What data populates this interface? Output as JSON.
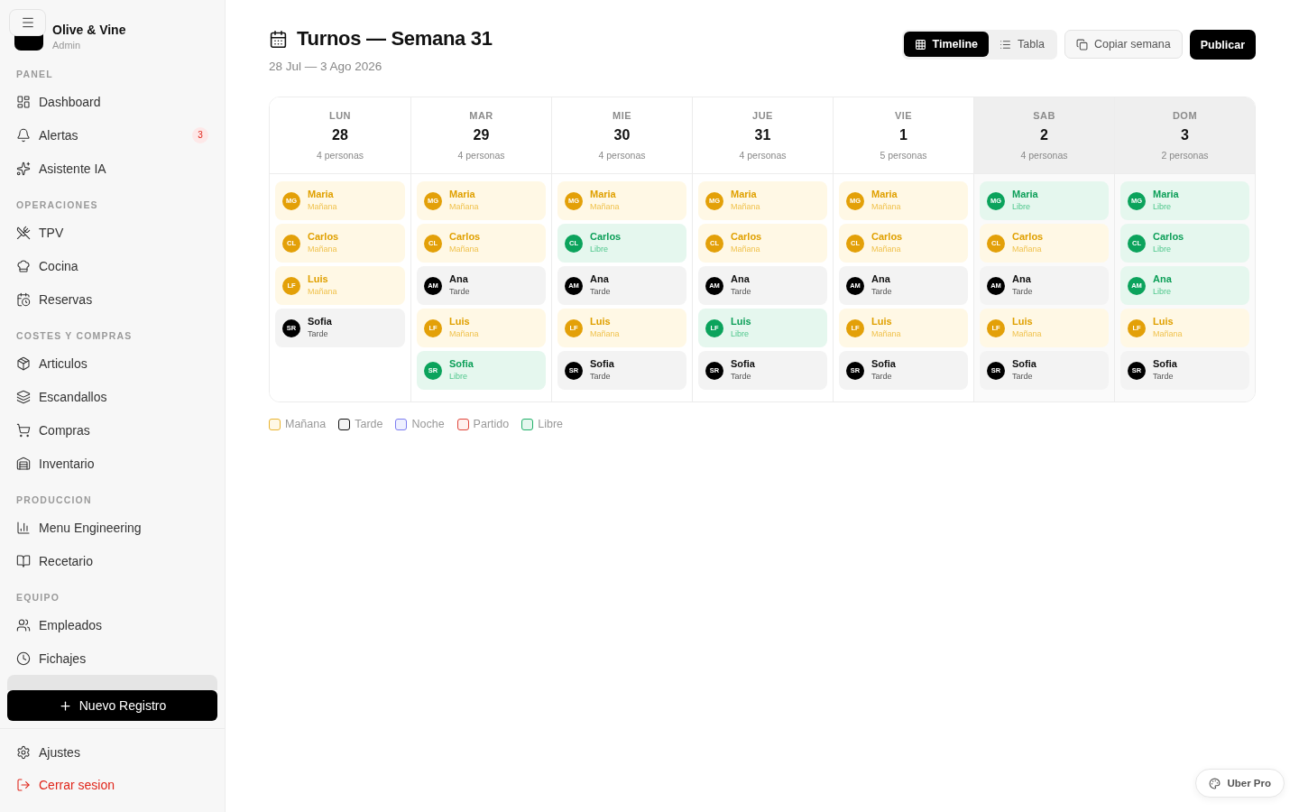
{
  "sidebar": {
    "brand": {
      "name": "Olive & Vine",
      "role": "Admin"
    },
    "sections": [
      {
        "title": "PANEL",
        "items": [
          {
            "label": "Dashboard",
            "selected": false
          },
          {
            "label": "Alertas",
            "badge": "3",
            "selected": false
          },
          {
            "label": "Asistente IA",
            "selected": false
          }
        ]
      },
      {
        "title": "OPERACIONES",
        "items": [
          {
            "label": "TPV",
            "selected": false
          },
          {
            "label": "Cocina",
            "selected": false
          },
          {
            "label": "Reservas",
            "selected": false
          }
        ]
      },
      {
        "title": "COSTES Y COMPRAS",
        "items": [
          {
            "label": "Articulos",
            "selected": false
          },
          {
            "label": "Escandallos",
            "selected": false
          },
          {
            "label": "Compras",
            "selected": false
          },
          {
            "label": "Inventario",
            "selected": false
          }
        ]
      },
      {
        "title": "PRODUCCION",
        "items": [
          {
            "label": "Menu Engineering",
            "selected": false
          },
          {
            "label": "Recetario",
            "selected": false
          }
        ]
      },
      {
        "title": "EQUIPO",
        "items": [
          {
            "label": "Empleados",
            "selected": false
          },
          {
            "label": "Fichajes",
            "selected": false
          },
          {
            "selected": true
          }
        ]
      }
    ],
    "primary_button": "Nuevo Registro",
    "footer": [
      {
        "label": "Ajustes",
        "kind": "normal"
      },
      {
        "label": "Cerrar sesion",
        "kind": "danger"
      }
    ]
  },
  "header": {
    "title": "Turnos — Semana 31",
    "subtitle": "28 Jul — 3 Ago 2026",
    "views": [
      {
        "label": "Timeline",
        "selected": true
      },
      {
        "label": "Tabla",
        "selected": false
      }
    ],
    "copy_button": "Copiar semana",
    "publish_button": "Publicar"
  },
  "days": [
    {
      "dow": "LUN",
      "date": "28",
      "count": "4 personas",
      "weekend": false,
      "shifts": [
        {
          "initials": "MG",
          "name": "Maria",
          "shift": "Mañana",
          "kind": "manana"
        },
        {
          "initials": "CL",
          "name": "Carlos",
          "shift": "Mañana",
          "kind": "manana"
        },
        {
          "initials": "LF",
          "name": "Luis",
          "shift": "Mañana",
          "kind": "manana"
        },
        {
          "initials": "SR",
          "name": "Sofia",
          "shift": "Tarde",
          "kind": "tarde"
        }
      ]
    },
    {
      "dow": "MAR",
      "date": "29",
      "count": "4 personas",
      "weekend": false,
      "shifts": [
        {
          "initials": "MG",
          "name": "Maria",
          "shift": "Mañana",
          "kind": "manana"
        },
        {
          "initials": "CL",
          "name": "Carlos",
          "shift": "Mañana",
          "kind": "manana"
        },
        {
          "initials": "AM",
          "name": "Ana",
          "shift": "Tarde",
          "kind": "tarde"
        },
        {
          "initials": "LF",
          "name": "Luis",
          "shift": "Mañana",
          "kind": "manana"
        },
        {
          "initials": "SR",
          "name": "Sofia",
          "shift": "Libre",
          "kind": "libre"
        }
      ]
    },
    {
      "dow": "MIE",
      "date": "30",
      "count": "4 personas",
      "weekend": false,
      "shifts": [
        {
          "initials": "MG",
          "name": "Maria",
          "shift": "Mañana",
          "kind": "manana"
        },
        {
          "initials": "CL",
          "name": "Carlos",
          "shift": "Libre",
          "kind": "libre"
        },
        {
          "initials": "AM",
          "name": "Ana",
          "shift": "Tarde",
          "kind": "tarde"
        },
        {
          "initials": "LF",
          "name": "Luis",
          "shift": "Mañana",
          "kind": "manana"
        },
        {
          "initials": "SR",
          "name": "Sofia",
          "shift": "Tarde",
          "kind": "tarde"
        }
      ]
    },
    {
      "dow": "JUE",
      "date": "31",
      "count": "4 personas",
      "weekend": false,
      "shifts": [
        {
          "initials": "MG",
          "name": "Maria",
          "shift": "Mañana",
          "kind": "manana"
        },
        {
          "initials": "CL",
          "name": "Carlos",
          "shift": "Mañana",
          "kind": "manana"
        },
        {
          "initials": "AM",
          "name": "Ana",
          "shift": "Tarde",
          "kind": "tarde"
        },
        {
          "initials": "LF",
          "name": "Luis",
          "shift": "Libre",
          "kind": "libre"
        },
        {
          "initials": "SR",
          "name": "Sofia",
          "shift": "Tarde",
          "kind": "tarde"
        }
      ]
    },
    {
      "dow": "VIE",
      "date": "1",
      "count": "5 personas",
      "weekend": false,
      "shifts": [
        {
          "initials": "MG",
          "name": "Maria",
          "shift": "Mañana",
          "kind": "manana"
        },
        {
          "initials": "CL",
          "name": "Carlos",
          "shift": "Mañana",
          "kind": "manana"
        },
        {
          "initials": "AM",
          "name": "Ana",
          "shift": "Tarde",
          "kind": "tarde"
        },
        {
          "initials": "LF",
          "name": "Luis",
          "shift": "Mañana",
          "kind": "manana"
        },
        {
          "initials": "SR",
          "name": "Sofia",
          "shift": "Tarde",
          "kind": "tarde"
        }
      ]
    },
    {
      "dow": "SAB",
      "date": "2",
      "count": "4 personas",
      "weekend": true,
      "shifts": [
        {
          "initials": "MG",
          "name": "Maria",
          "shift": "Libre",
          "kind": "libre"
        },
        {
          "initials": "CL",
          "name": "Carlos",
          "shift": "Mañana",
          "kind": "manana"
        },
        {
          "initials": "AM",
          "name": "Ana",
          "shift": "Tarde",
          "kind": "tarde"
        },
        {
          "initials": "LF",
          "name": "Luis",
          "shift": "Mañana",
          "kind": "manana"
        },
        {
          "initials": "SR",
          "name": "Sofia",
          "shift": "Tarde",
          "kind": "tarde"
        }
      ]
    },
    {
      "dow": "DOM",
      "date": "3",
      "count": "2 personas",
      "weekend": true,
      "shifts": [
        {
          "initials": "MG",
          "name": "Maria",
          "shift": "Libre",
          "kind": "libre"
        },
        {
          "initials": "CL",
          "name": "Carlos",
          "shift": "Libre",
          "kind": "libre"
        },
        {
          "initials": "AM",
          "name": "Ana",
          "shift": "Libre",
          "kind": "libre"
        },
        {
          "initials": "LF",
          "name": "Luis",
          "shift": "Mañana",
          "kind": "manana"
        },
        {
          "initials": "SR",
          "name": "Sofia",
          "shift": "Tarde",
          "kind": "tarde"
        }
      ]
    }
  ],
  "legend": [
    {
      "label": "Mañana",
      "kind": "manana"
    },
    {
      "label": "Tarde",
      "kind": "tarde"
    },
    {
      "label": "Noche",
      "kind": "noche"
    },
    {
      "label": "Partido",
      "kind": "partido"
    },
    {
      "label": "Libre",
      "kind": "libre"
    }
  ],
  "floating_button": "Uber Pro"
}
